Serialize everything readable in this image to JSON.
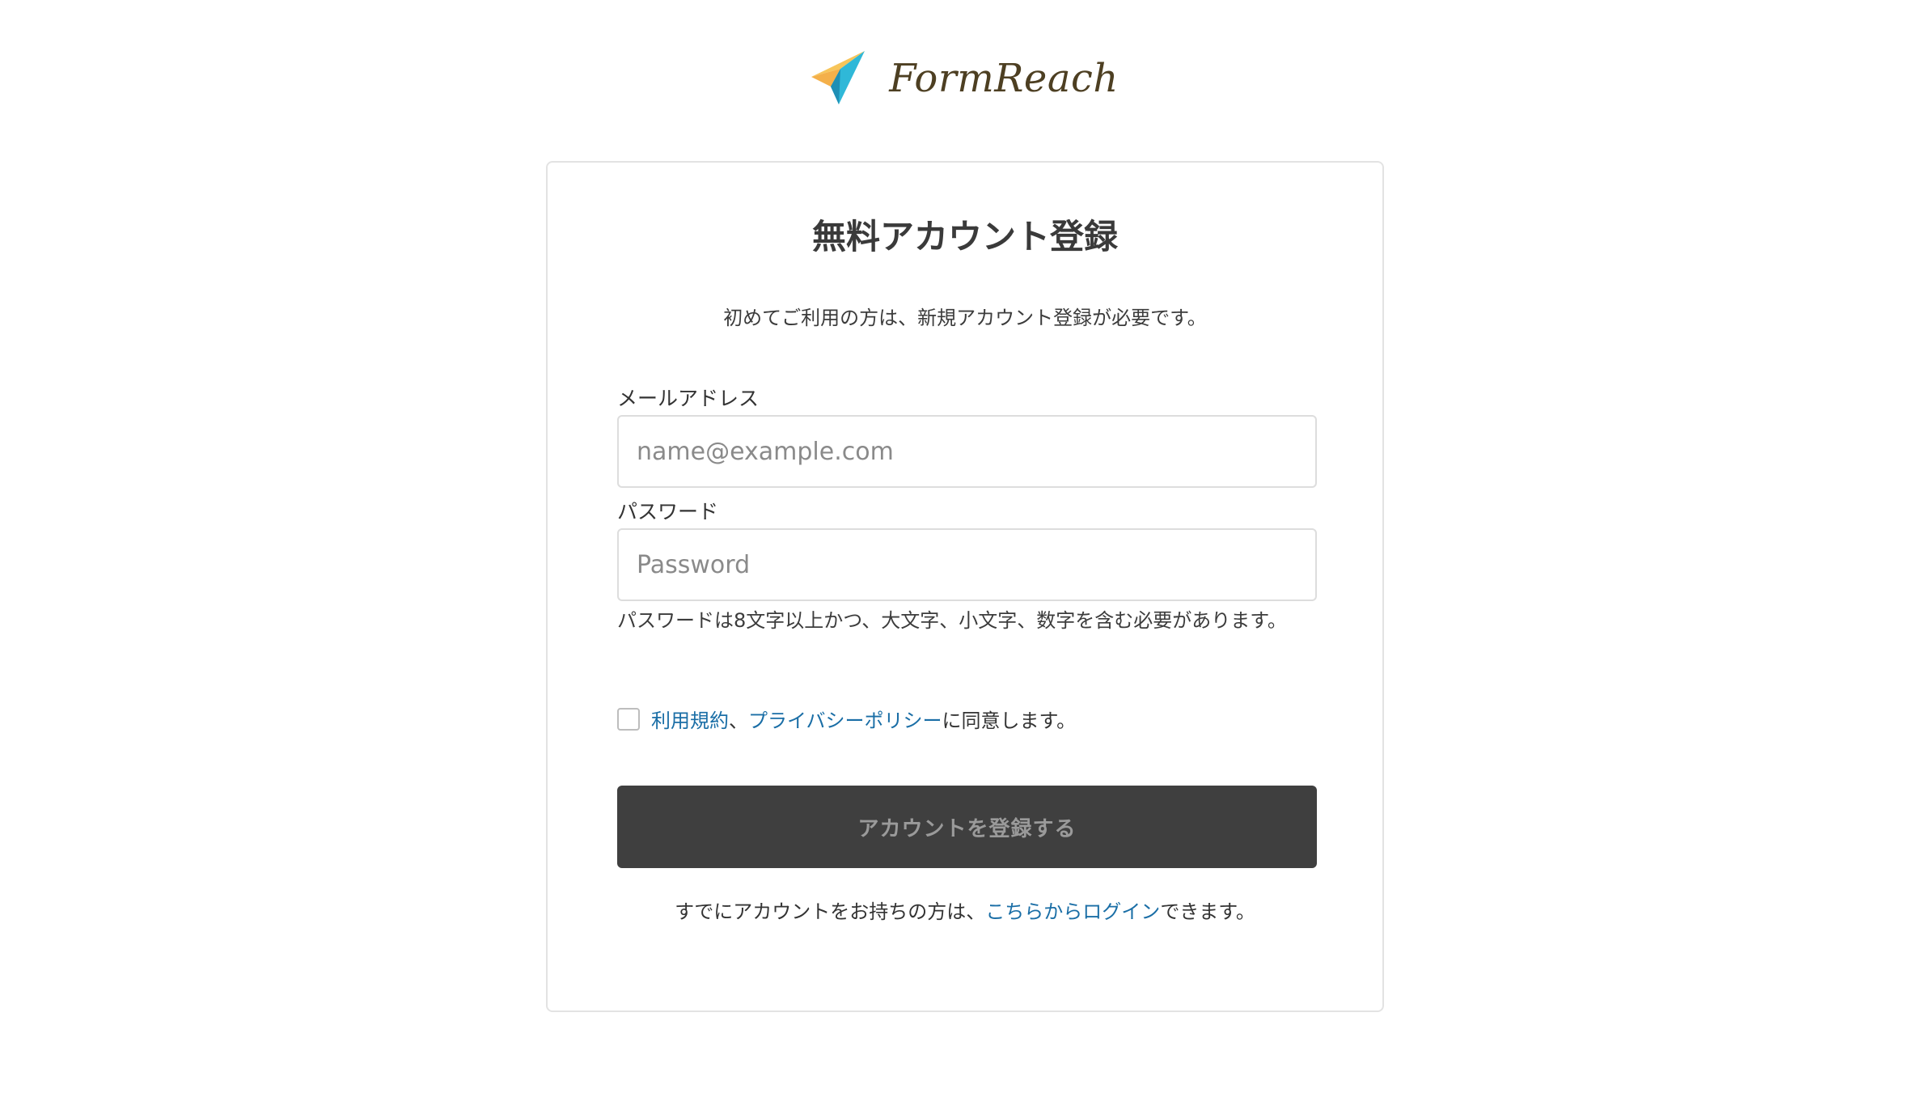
{
  "brand": {
    "name": "FormReach",
    "colors": {
      "logo_yellow": "#f7c55a",
      "logo_blue": "#2fb8d8",
      "logo_dark_blue": "#1e8fb5",
      "text": "#4d3f22"
    }
  },
  "card": {
    "title": "無料アカウント登録",
    "subtitle": "初めてご利用の方は、新規アカウント登録が必要です。"
  },
  "form": {
    "email_label": "メールアドレス",
    "email_placeholder": "name@example.com",
    "email_value": "",
    "password_label": "パスワード",
    "password_placeholder": "Password",
    "password_value": "",
    "password_help": "パスワードは8文字以上かつ、大文字、小文字、数字を含む必要があります。",
    "agree_checked": false,
    "terms_link": "利用規約",
    "agree_separator": "、",
    "privacy_link": "プライバシーポリシー",
    "agree_suffix": "に同意します。",
    "submit_label": "アカウントを登録する"
  },
  "login": {
    "prefix": "すでにアカウントをお持ちの方は、",
    "link": "こちらからログイン",
    "suffix": "できます。"
  },
  "colors": {
    "link": "#1a6ea6",
    "button_bg": "#3f3f3f",
    "button_text": "#9a9a9a",
    "card_border": "#e3e3e3"
  }
}
